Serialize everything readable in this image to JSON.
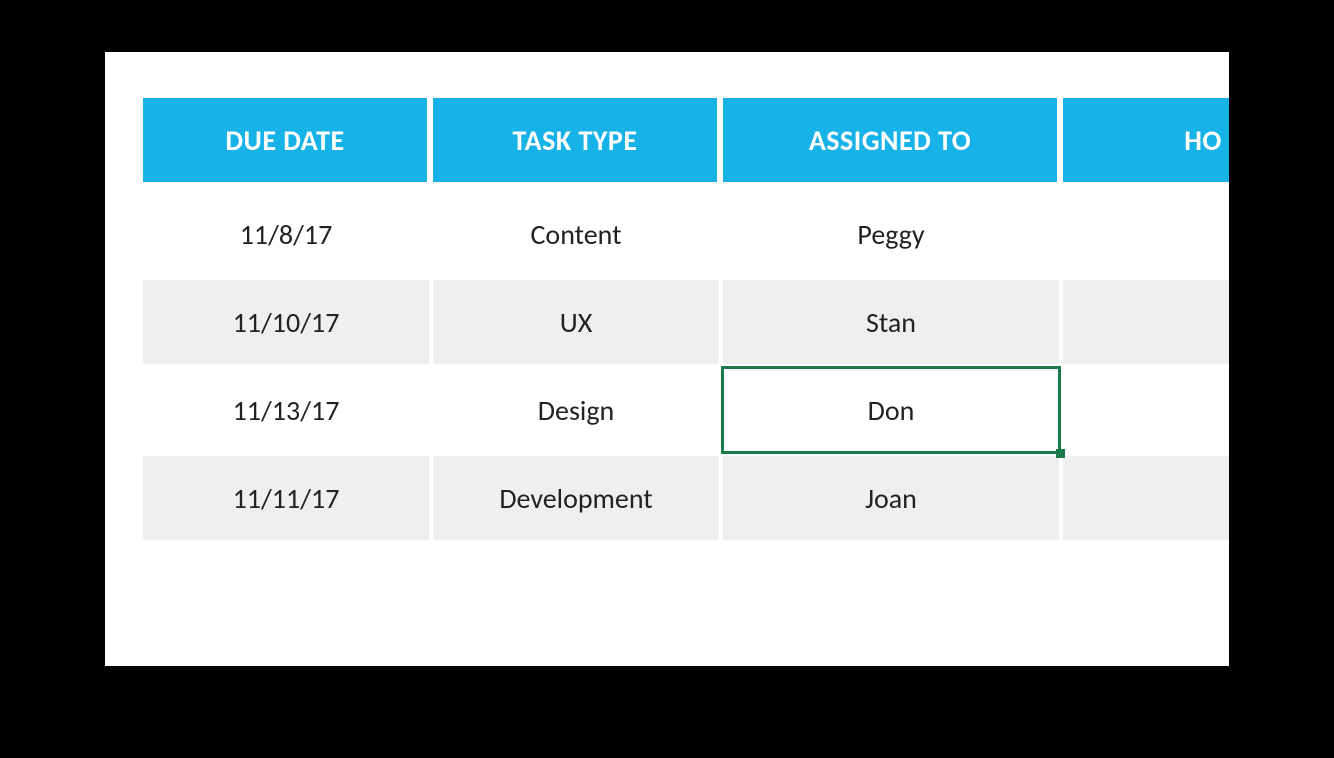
{
  "table": {
    "headers": [
      "DUE DATE",
      "TASK TYPE",
      "ASSIGNED TO",
      "HO"
    ],
    "rows": [
      {
        "due_date": "11/8/17",
        "task_type": "Content",
        "assigned_to": "Peggy",
        "col4": ""
      },
      {
        "due_date": "11/10/17",
        "task_type": "UX",
        "assigned_to": "Stan",
        "col4": ""
      },
      {
        "due_date": "11/13/17",
        "task_type": "Design",
        "assigned_to": "Don",
        "col4": ""
      },
      {
        "due_date": "11/11/17",
        "task_type": "Development",
        "assigned_to": "Joan",
        "col4": ""
      }
    ],
    "selected_cell": {
      "row": 2,
      "col": "assigned_to"
    }
  }
}
